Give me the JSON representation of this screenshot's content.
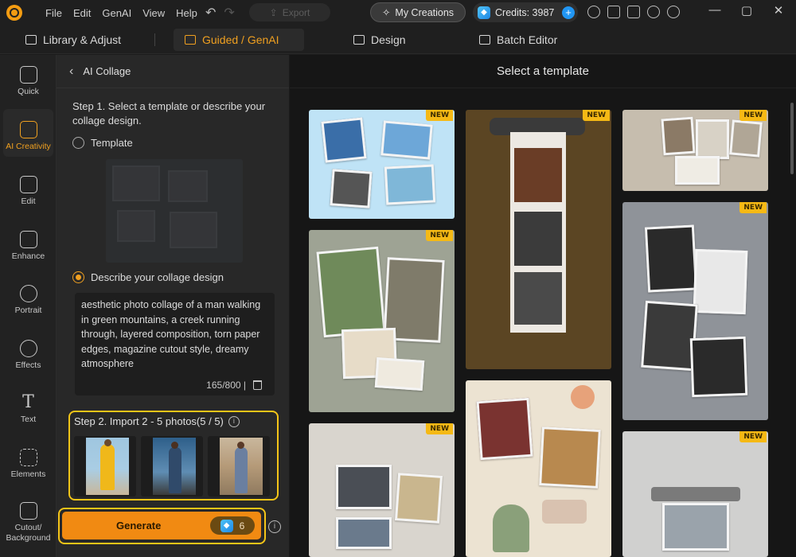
{
  "menu": [
    "File",
    "Edit",
    "GenAI",
    "View",
    "Help"
  ],
  "toolbar": {
    "export_label": "Export",
    "my_creations_label": "My Creations",
    "credits_label": "Credits: 3987"
  },
  "tabs": [
    {
      "label": "Library & Adjust"
    },
    {
      "label": "Guided / GenAI"
    },
    {
      "label": "Design"
    },
    {
      "label": "Batch Editor"
    }
  ],
  "rail": [
    {
      "label": "Quick"
    },
    {
      "label": "AI Creativity"
    },
    {
      "label": "Edit"
    },
    {
      "label": "Enhance"
    },
    {
      "label": "Portrait"
    },
    {
      "label": "Effects"
    },
    {
      "label": "Text"
    },
    {
      "label": "Elements"
    },
    {
      "label": "Cutout/ Background"
    }
  ],
  "panel": {
    "title": "AI Collage",
    "step1": "Step 1. Select a template or describe your collage design.",
    "option_template": "Template",
    "option_describe": "Describe your collage design",
    "description": "aesthetic photo collage of a man walking in green mountains, a creek running through, layered composition, torn paper edges, magazine cutout style, dreamy atmosphere",
    "char_count": "165/800 |",
    "step2": "Step 2. Import 2 - 5 photos(5 / 5)",
    "generate_label": "Generate",
    "generate_cost": "6"
  },
  "main": {
    "title": "Select a template",
    "badge": "NEW"
  },
  "colors": {
    "accent": "#f0a020",
    "highlight": "#f5c518",
    "generate": "#f18a12"
  }
}
